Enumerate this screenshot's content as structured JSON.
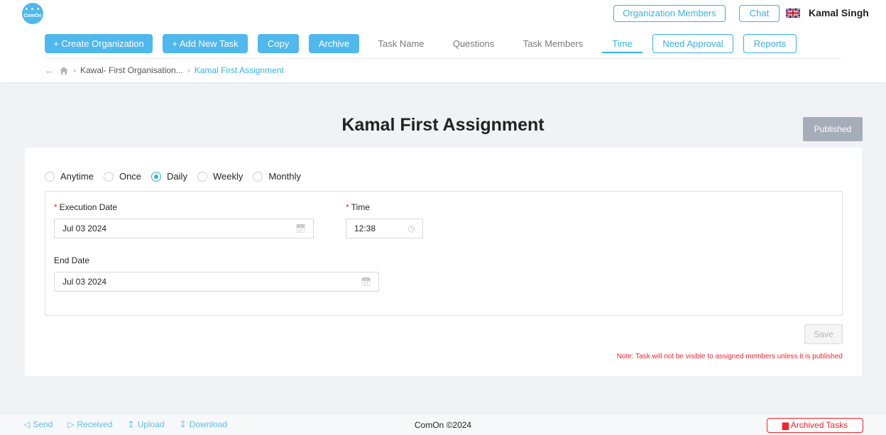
{
  "app": {
    "logo_text": "ComOn"
  },
  "header": {
    "org_members_label": "Organization Members",
    "chat_label": "Chat",
    "user_name": "Kamal Singh"
  },
  "toolbar": {
    "create_org": "+ Create Organization",
    "add_task": "+ Add New Task",
    "copy": "Copy",
    "archive": "Archive",
    "tabs": [
      "Task Name",
      "Questions",
      "Task Members",
      "Time"
    ],
    "need_approval": "Need Approval",
    "reports": "Reports"
  },
  "breadcrumb": {
    "org": "Kawal- First Organisation...",
    "current": "Kamal First Assignment"
  },
  "page": {
    "title": "Kamal First Assignment",
    "status": "Published"
  },
  "schedule": {
    "options": [
      "Anytime",
      "Once",
      "Daily",
      "Weekly",
      "Monthly"
    ],
    "selected": "Daily",
    "execution_date_label": "Execution Date",
    "execution_date_value": "Jul 03 2024",
    "time_label": "Time",
    "time_value": "12:38",
    "end_date_label": "End Date",
    "end_date_value": "Jul 03 2024",
    "save_label": "Save",
    "note": "Note: Task will not be visible to assigned members unless it is published"
  },
  "footer": {
    "send": "Send",
    "received": "Received",
    "upload": "Upload",
    "download": "Download",
    "copyright": "ComOn ©2024",
    "archived_tasks": "Archived Tasks"
  },
  "colors": {
    "accent": "#36b2e6",
    "primary_button": "#4fb8ec",
    "danger": "#f5222d",
    "published": "#a6adb8"
  }
}
